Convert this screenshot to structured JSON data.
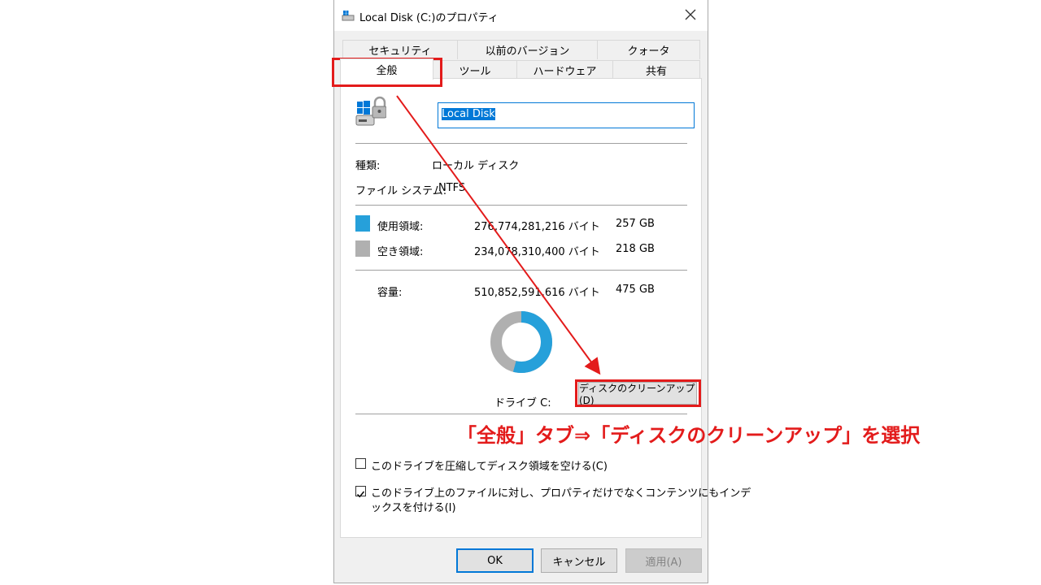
{
  "window": {
    "title": "Local Disk (C:)のプロパティ",
    "icon": "drive-icon",
    "close_icon": "close-icon"
  },
  "tabs": {
    "row1": [
      "セキュリティ",
      "以前のバージョン",
      "クォータ"
    ],
    "row2": [
      "全般",
      "ツール",
      "ハードウェア",
      "共有"
    ],
    "active": "全般"
  },
  "general": {
    "name_value": "Local Disk",
    "type_label": "種類:",
    "type_value": "ローカル ディスク",
    "fs_label": "ファイル システム:",
    "fs_value": "NTFS",
    "used_label": "使用領域:",
    "used_bytes": "276,774,281,216 バイト",
    "used_gb": "257 GB",
    "free_label": "空き領域:",
    "free_bytes": "234,078,310,400 バイト",
    "free_gb": "218 GB",
    "capacity_label": "容量:",
    "capacity_bytes": "510,852,591,616 バイト",
    "capacity_gb": "475 GB",
    "drive_label": "ドライブ C:",
    "cleanup_button": "ディスクのクリーンアップ(D)",
    "compress_label": "このドライブを圧縮してディスク領域を空ける(C)",
    "compress_checked": false,
    "index_label_1": "このドライブ上のファイルに対し、プロパティだけでなくコンテンツにもインデ",
    "index_label_2": "ックスを付ける(I)",
    "index_checked": true,
    "used_fraction": 0.542
  },
  "buttons": {
    "ok": "OK",
    "cancel": "キャンセル",
    "apply": "適用(A)"
  },
  "colors": {
    "used": "#26a0da",
    "free": "#b0b0b0",
    "annotation": "#e31b1b",
    "selection": "#0078d7"
  },
  "annotation": {
    "text": "「全般」タブ⇒「ディスクのクリーンアップ」を選択"
  }
}
